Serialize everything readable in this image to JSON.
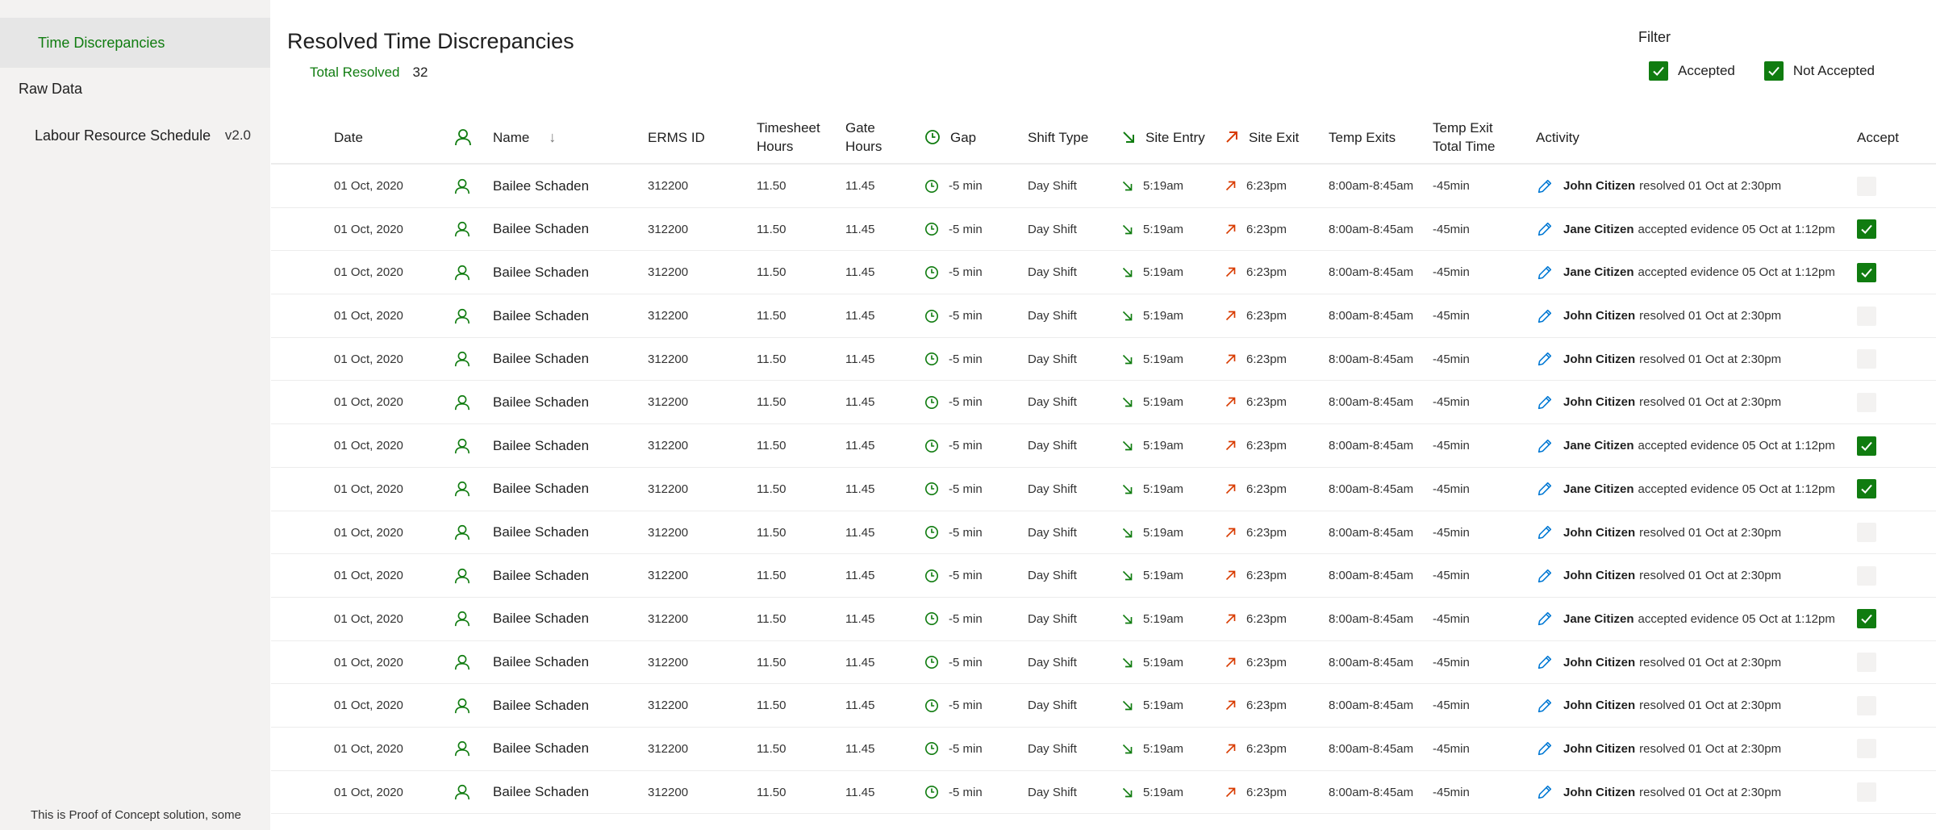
{
  "sidebar": {
    "items": [
      {
        "label": "Time Discrepancies",
        "version": ""
      },
      {
        "label": "Raw Data",
        "version": ""
      },
      {
        "label": "Labour Resource Schedule",
        "version": "v2.0"
      }
    ],
    "footer": "This is Proof of Concept solution, some"
  },
  "header": {
    "title": "Resolved Time Discrepancies",
    "summary_label": "Total Resolved",
    "summary_value": "32"
  },
  "filter": {
    "title": "Filter",
    "options": [
      {
        "label": "Accepted",
        "checked": true
      },
      {
        "label": "Not Accepted",
        "checked": true
      }
    ]
  },
  "table": {
    "columns": {
      "date": "Date",
      "name": "Name",
      "erms": "ERMS ID",
      "timesheet_l1": "Timesheet",
      "timesheet_l2": "Hours",
      "gate_l1": "Gate",
      "gate_l2": "Hours",
      "gap": "Gap",
      "shift": "Shift Type",
      "entry": "Site Entry",
      "exit": "Site Exit",
      "temp": "Temp Exits",
      "tempt_l1": "Temp Exit",
      "tempt_l2": "Total Time",
      "activity": "Activity",
      "accept": "Accept"
    },
    "rows": [
      {
        "date": "01 Oct, 2020",
        "name": "Bailee Schaden",
        "erms": "312200",
        "timesheet": "11.50",
        "gate": "11.45",
        "gap": "-5 min",
        "shift": "Day Shift",
        "entry": "5:19am",
        "exit": "6:23pm",
        "temp": "8:00am-8:45am",
        "tempt": "-45min",
        "actor": "John Citizen",
        "activity": "resolved 01 Oct at 2:30pm",
        "accepted": false
      },
      {
        "date": "01 Oct, 2020",
        "name": "Bailee Schaden",
        "erms": "312200",
        "timesheet": "11.50",
        "gate": "11.45",
        "gap": "-5 min",
        "shift": "Day Shift",
        "entry": "5:19am",
        "exit": "6:23pm",
        "temp": "8:00am-8:45am",
        "tempt": "-45min",
        "actor": "Jane Citizen",
        "activity": "accepted evidence 05 Oct at 1:12pm",
        "accepted": true
      },
      {
        "date": "01 Oct, 2020",
        "name": "Bailee Schaden",
        "erms": "312200",
        "timesheet": "11.50",
        "gate": "11.45",
        "gap": "-5 min",
        "shift": "Day Shift",
        "entry": "5:19am",
        "exit": "6:23pm",
        "temp": "8:00am-8:45am",
        "tempt": "-45min",
        "actor": "Jane Citizen",
        "activity": "accepted evidence 05 Oct at 1:12pm",
        "accepted": true
      },
      {
        "date": "01 Oct, 2020",
        "name": "Bailee Schaden",
        "erms": "312200",
        "timesheet": "11.50",
        "gate": "11.45",
        "gap": "-5 min",
        "shift": "Day Shift",
        "entry": "5:19am",
        "exit": "6:23pm",
        "temp": "8:00am-8:45am",
        "tempt": "-45min",
        "actor": "John Citizen",
        "activity": "resolved 01 Oct at 2:30pm",
        "accepted": false
      },
      {
        "date": "01 Oct, 2020",
        "name": "Bailee Schaden",
        "erms": "312200",
        "timesheet": "11.50",
        "gate": "11.45",
        "gap": "-5 min",
        "shift": "Day Shift",
        "entry": "5:19am",
        "exit": "6:23pm",
        "temp": "8:00am-8:45am",
        "tempt": "-45min",
        "actor": "John Citizen",
        "activity": "resolved 01 Oct at 2:30pm",
        "accepted": false
      },
      {
        "date": "01 Oct, 2020",
        "name": "Bailee Schaden",
        "erms": "312200",
        "timesheet": "11.50",
        "gate": "11.45",
        "gap": "-5 min",
        "shift": "Day Shift",
        "entry": "5:19am",
        "exit": "6:23pm",
        "temp": "8:00am-8:45am",
        "tempt": "-45min",
        "actor": "John Citizen",
        "activity": "resolved 01 Oct at 2:30pm",
        "accepted": false
      },
      {
        "date": "01 Oct, 2020",
        "name": "Bailee Schaden",
        "erms": "312200",
        "timesheet": "11.50",
        "gate": "11.45",
        "gap": "-5 min",
        "shift": "Day Shift",
        "entry": "5:19am",
        "exit": "6:23pm",
        "temp": "8:00am-8:45am",
        "tempt": "-45min",
        "actor": "Jane Citizen",
        "activity": "accepted evidence 05 Oct at 1:12pm",
        "accepted": true
      },
      {
        "date": "01 Oct, 2020",
        "name": "Bailee Schaden",
        "erms": "312200",
        "timesheet": "11.50",
        "gate": "11.45",
        "gap": "-5 min",
        "shift": "Day Shift",
        "entry": "5:19am",
        "exit": "6:23pm",
        "temp": "8:00am-8:45am",
        "tempt": "-45min",
        "actor": "Jane Citizen",
        "activity": "accepted evidence 05 Oct at 1:12pm",
        "accepted": true
      },
      {
        "date": "01 Oct, 2020",
        "name": "Bailee Schaden",
        "erms": "312200",
        "timesheet": "11.50",
        "gate": "11.45",
        "gap": "-5 min",
        "shift": "Day Shift",
        "entry": "5:19am",
        "exit": "6:23pm",
        "temp": "8:00am-8:45am",
        "tempt": "-45min",
        "actor": "John Citizen",
        "activity": "resolved 01 Oct at 2:30pm",
        "accepted": false
      },
      {
        "date": "01 Oct, 2020",
        "name": "Bailee Schaden",
        "erms": "312200",
        "timesheet": "11.50",
        "gate": "11.45",
        "gap": "-5 min",
        "shift": "Day Shift",
        "entry": "5:19am",
        "exit": "6:23pm",
        "temp": "8:00am-8:45am",
        "tempt": "-45min",
        "actor": "John Citizen",
        "activity": "resolved 01 Oct at 2:30pm",
        "accepted": false
      },
      {
        "date": "01 Oct, 2020",
        "name": "Bailee Schaden",
        "erms": "312200",
        "timesheet": "11.50",
        "gate": "11.45",
        "gap": "-5 min",
        "shift": "Day Shift",
        "entry": "5:19am",
        "exit": "6:23pm",
        "temp": "8:00am-8:45am",
        "tempt": "-45min",
        "actor": "Jane Citizen",
        "activity": "accepted evidence 05 Oct at 1:12pm",
        "accepted": true
      },
      {
        "date": "01 Oct, 2020",
        "name": "Bailee Schaden",
        "erms": "312200",
        "timesheet": "11.50",
        "gate": "11.45",
        "gap": "-5 min",
        "shift": "Day Shift",
        "entry": "5:19am",
        "exit": "6:23pm",
        "temp": "8:00am-8:45am",
        "tempt": "-45min",
        "actor": "John Citizen",
        "activity": "resolved 01 Oct at 2:30pm",
        "accepted": false
      },
      {
        "date": "01 Oct, 2020",
        "name": "Bailee Schaden",
        "erms": "312200",
        "timesheet": "11.50",
        "gate": "11.45",
        "gap": "-5 min",
        "shift": "Day Shift",
        "entry": "5:19am",
        "exit": "6:23pm",
        "temp": "8:00am-8:45am",
        "tempt": "-45min",
        "actor": "John Citizen",
        "activity": "resolved 01 Oct at 2:30pm",
        "accepted": false
      },
      {
        "date": "01 Oct, 2020",
        "name": "Bailee Schaden",
        "erms": "312200",
        "timesheet": "11.50",
        "gate": "11.45",
        "gap": "-5 min",
        "shift": "Day Shift",
        "entry": "5:19am",
        "exit": "6:23pm",
        "temp": "8:00am-8:45am",
        "tempt": "-45min",
        "actor": "John Citizen",
        "activity": "resolved 01 Oct at 2:30pm",
        "accepted": false
      },
      {
        "date": "01 Oct, 2020",
        "name": "Bailee Schaden",
        "erms": "312200",
        "timesheet": "11.50",
        "gate": "11.45",
        "gap": "-5 min",
        "shift": "Day Shift",
        "entry": "5:19am",
        "exit": "6:23pm",
        "temp": "8:00am-8:45am",
        "tempt": "-45min",
        "actor": "John Citizen",
        "activity": "resolved 01 Oct at 2:30pm",
        "accepted": false
      }
    ]
  },
  "colors": {
    "accent": "#107c10",
    "entry_arrow": "#107c10",
    "exit_arrow": "#d83b01",
    "edit_icon": "#0078d4",
    "sidebar_bg": "#f3f2f1"
  },
  "icons": {
    "person": "person-icon",
    "clock": "clock-icon",
    "entry": "arrow-down-right-icon",
    "exit": "arrow-up-right-icon",
    "edit": "pencil-icon",
    "check": "checkmark-icon",
    "sort": "sort-down-icon"
  }
}
